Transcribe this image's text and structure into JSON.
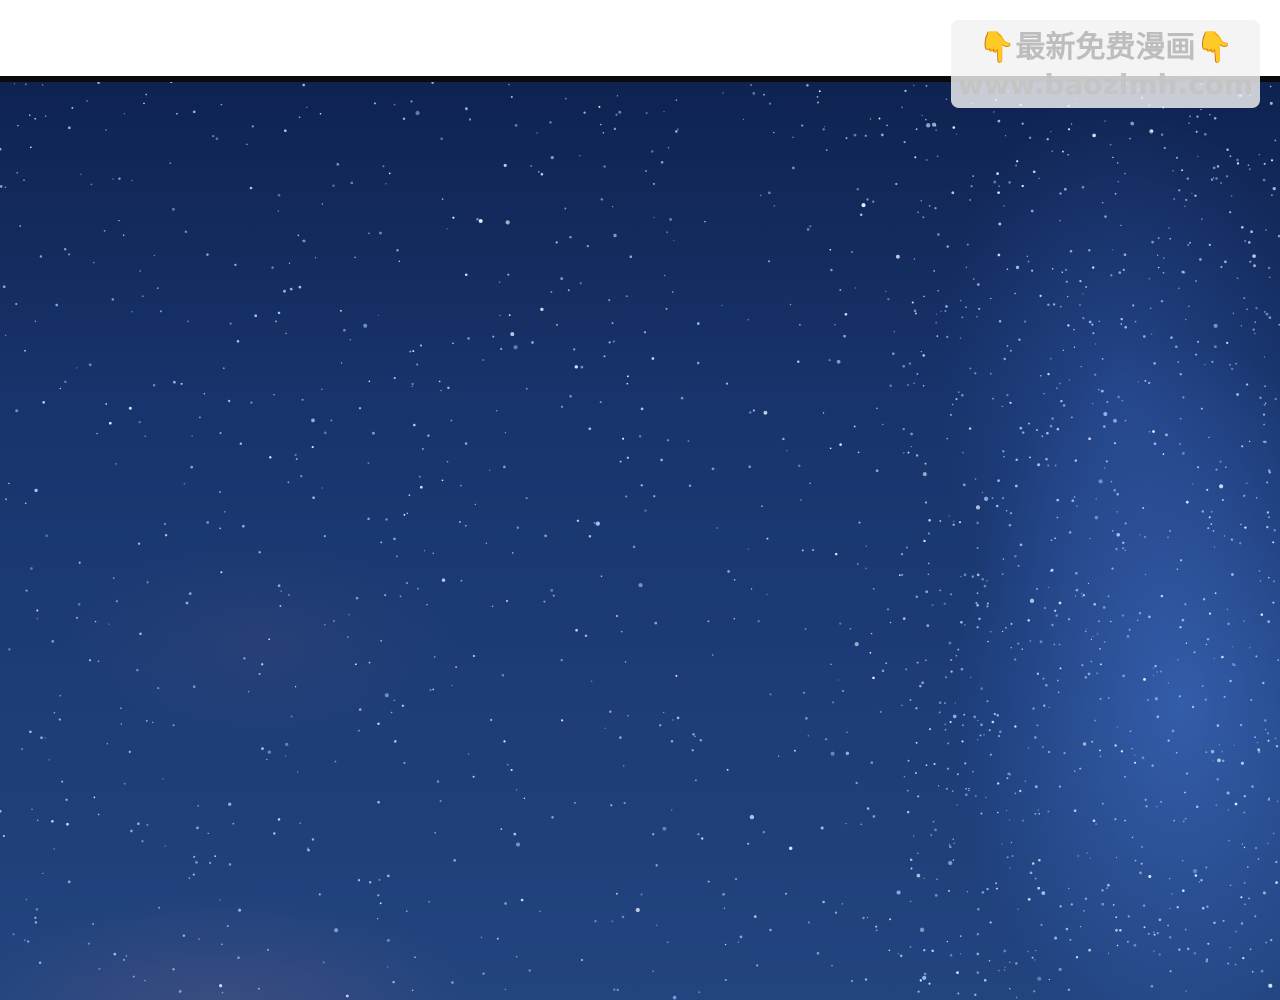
{
  "watermark": {
    "emoji_left": "👇",
    "title": "最新免费漫画",
    "emoji_right": "👇",
    "url": "www.baozimh.com"
  },
  "colors": {
    "sky_top": "#0e2350",
    "sky_bottom": "#22447f",
    "milky_way": "#4678d2",
    "border": "#0b0b0d",
    "watermark_bg": "#f2f2f2",
    "watermark_text": "#bdbdbd",
    "emoji": "#f4b400"
  }
}
